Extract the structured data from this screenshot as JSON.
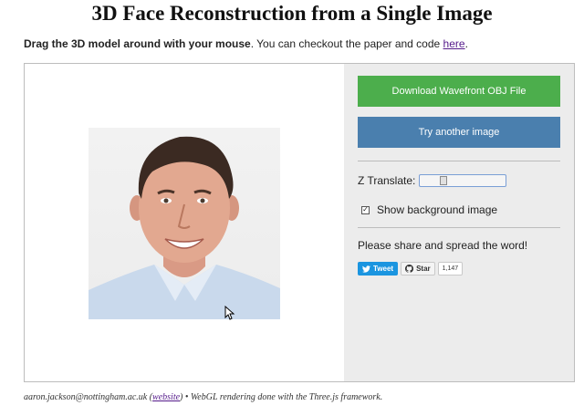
{
  "page": {
    "title": "3D Face Reconstruction from a Single Image"
  },
  "intro": {
    "bold_text": "Drag the 3D model around with your mouse",
    "text": ". You can checkout the paper and code ",
    "link_text": "here",
    "end": "."
  },
  "panel": {
    "download_button": "Download Wavefront OBJ File",
    "try_button": "Try another image",
    "z_translate_label": "Z Translate:",
    "z_translate_value": 0.25,
    "show_bg_label": "Show background image",
    "show_bg_checked": true,
    "checkmark": "✓",
    "share_text": "Please share and spread the word!",
    "tweet_label": "Tweet",
    "star_label": "Star",
    "star_count": "1,147"
  },
  "footer": {
    "email": "aaron.jackson@nottingham.ac.uk",
    "open_paren": " (",
    "website_link": "website",
    "rest": ") • WebGL rendering done with the Three.js framework."
  },
  "colors": {
    "download_button": "#4cae4c",
    "try_button": "#4a7fae",
    "tweet": "#1b95e0",
    "link": "#551a8b",
    "panel_bg": "#ececec"
  },
  "icons": [
    "twitter-bird-icon",
    "github-icon",
    "cursor-icon"
  ]
}
